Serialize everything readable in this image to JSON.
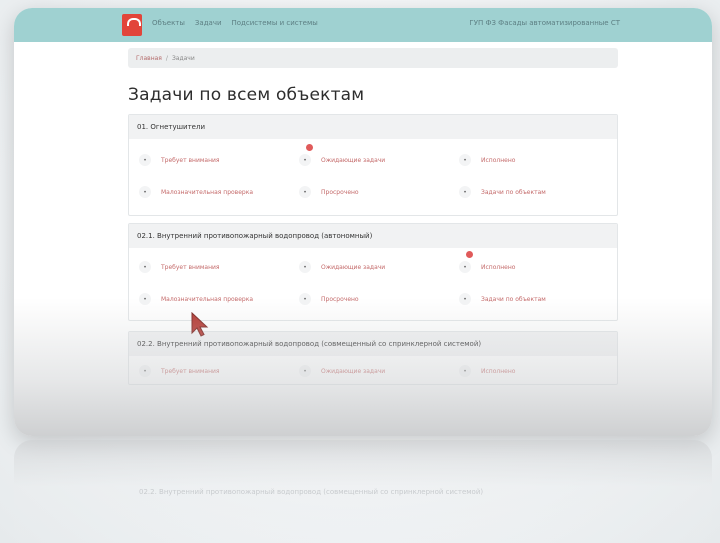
{
  "header": {
    "nav": [
      "Объекты",
      "Задачи",
      "Подсистемы и системы"
    ],
    "user": "ГУП ФЗ Фасады автоматизированные СТ"
  },
  "breadcrumb": {
    "home": "Главная",
    "sep": "/",
    "current": "Задачи"
  },
  "page_title": "Задачи по всем объектам",
  "sections": [
    {
      "title": "01. Огнетушители",
      "items": [
        {
          "label": "Требует внимания",
          "badge": false
        },
        {
          "label": "Ожидающие задачи",
          "badge": true
        },
        {
          "label": "Исполнено",
          "badge": false
        },
        {
          "label": "Малозначительная проверка",
          "badge": false
        },
        {
          "label": "Просрочено",
          "badge": false
        },
        {
          "label": "Задачи по объектам",
          "badge": false
        }
      ]
    },
    {
      "title": "02.1. Внутренний противопожарный водопровод (автономный)",
      "items": [
        {
          "label": "Требует внимания",
          "badge": false
        },
        {
          "label": "Ожидающие задачи",
          "badge": false
        },
        {
          "label": "Исполнено",
          "badge": true
        },
        {
          "label": "Малозначительная проверка",
          "badge": false
        },
        {
          "label": "Просрочено",
          "badge": false
        },
        {
          "label": "Задачи по объектам",
          "badge": false
        }
      ]
    },
    {
      "title": "02.2. Внутренний противопожарный водопровод (совмещенный со спринклерной системой)",
      "items": [
        {
          "label": "Требует внимания",
          "badge": false
        },
        {
          "label": "Ожидающие задачи",
          "badge": false
        },
        {
          "label": "Исполнено",
          "badge": false
        }
      ]
    }
  ],
  "reflection_text": "02.2. Внутренний противопожарный водопровод (совмещенный со спринклерной системой)",
  "colors": {
    "topbar": "#9fd1d1",
    "logo": "#e2453a",
    "link": "#c46a6a",
    "badge": "#e05a5a"
  }
}
